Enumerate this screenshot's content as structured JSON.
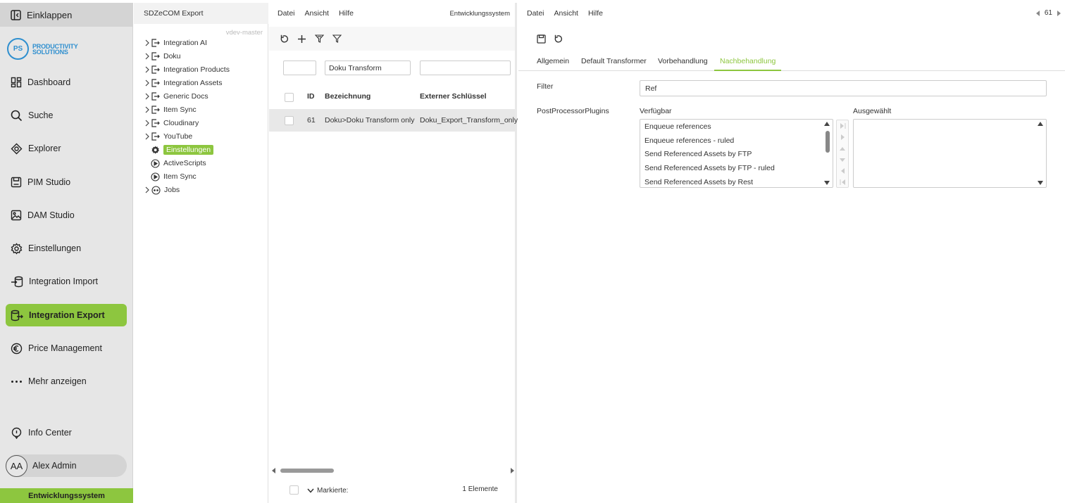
{
  "nav": {
    "collapse_label": "Einklappen",
    "logo": {
      "initials": "PS",
      "line1": "PRODUCTIVITY",
      "line2": "SOLUTIONS"
    },
    "items": [
      {
        "label": "Dashboard",
        "icon": "dashboard-icon"
      },
      {
        "label": "Suche",
        "icon": "search-icon"
      },
      {
        "label": "Explorer",
        "icon": "explorer-icon"
      },
      {
        "label": "PIM Studio",
        "icon": "pim-studio-icon"
      },
      {
        "label": "DAM Studio",
        "icon": "image-icon"
      },
      {
        "label": "Einstellungen",
        "icon": "gear-icon"
      },
      {
        "label": "Integration Import",
        "icon": "import-icon"
      },
      {
        "label": "Integration Export",
        "icon": "export-icon"
      },
      {
        "label": "Price Management",
        "icon": "euro-icon"
      },
      {
        "label": "Mehr anzeigen",
        "icon": "more-icon"
      }
    ],
    "info_center": "Info Center",
    "user": {
      "initials": "AA",
      "name": "Alex Admin"
    },
    "environment": "Entwicklungssystem",
    "accent_color": "#8dc63f"
  },
  "tree": {
    "title": "SDZeCOM Export",
    "version": "vdev-master",
    "nodes": [
      "Integration AI",
      "Doku",
      "Integration Products",
      "Integration Assets",
      "Generic Docs",
      "Item Sync",
      "Cloudinary",
      "YouTube"
    ],
    "settings_label": "Einstellungen",
    "leaves": [
      "ActiveScripts",
      "Item Sync"
    ],
    "jobs_label": "Jobs"
  },
  "list": {
    "menu": [
      "Datei",
      "Ansicht",
      "Hilfe"
    ],
    "environment": "Entwicklungssystem",
    "filters": {
      "id": "",
      "name": "Doku Transform",
      "key": ""
    },
    "columns": {
      "id": "ID",
      "name": "Bezeichnung",
      "key": "Externer Schlüssel"
    },
    "rows": [
      {
        "id": "61",
        "name": "Doku>Doku Transform only",
        "key": "Doku_Export_Transform_only"
      }
    ],
    "footer": {
      "marked_label": "Markierte:",
      "count_label": "1 Elemente"
    }
  },
  "detail": {
    "menu": [
      "Datei",
      "Ansicht",
      "Hilfe"
    ],
    "record_id": "61",
    "tabs": [
      "Allgemein",
      "Default Transformer",
      "Vorbehandlung",
      "Nachbehandlung"
    ],
    "active_tab": "Nachbehandlung",
    "filter_label": "Filter",
    "filter_value": "Ref",
    "plugins_label": "PostProcessorPlugins",
    "available_label": "Verfügbar",
    "selected_label": "Ausgewählt",
    "available": [
      "Enqueue references",
      "Enqueue references - ruled",
      "Send Referenced Assets by FTP",
      "Send Referenced Assets by FTP - ruled",
      "Send Referenced Assets by Rest"
    ],
    "selected": []
  }
}
